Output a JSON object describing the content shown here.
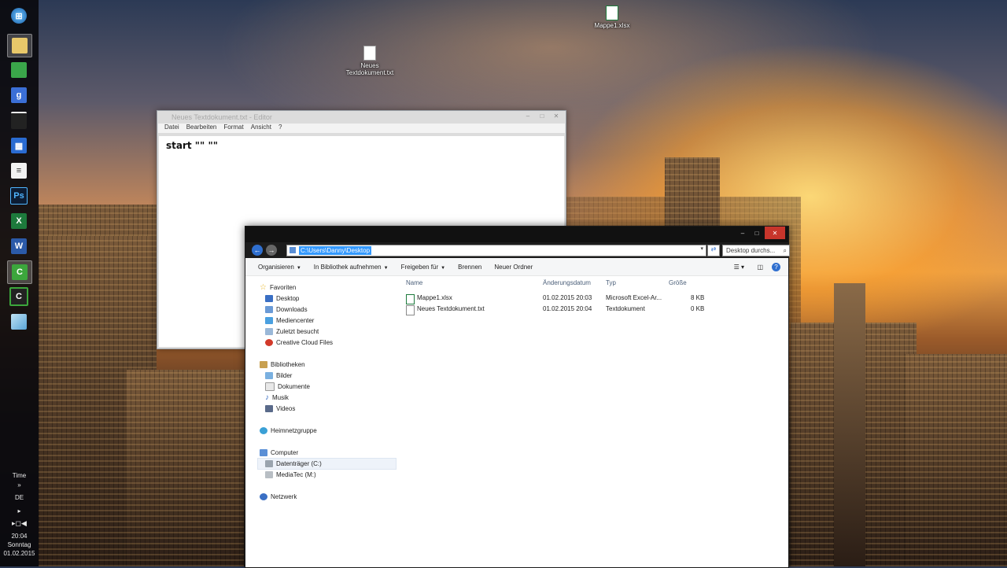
{
  "desktop": {
    "icons": [
      {
        "name": "Mappe1.xlsx"
      },
      {
        "name": "Neues Textdokument.txt"
      }
    ]
  },
  "taskbar": {
    "tray": {
      "time_label": "Time",
      "lang": "DE",
      "clock": "20:04",
      "day": "Sonntag",
      "date": "01.02.2015"
    }
  },
  "notepad": {
    "title": "Neues Textdokument.txt - Editor",
    "menu": [
      "Datei",
      "Bearbeiten",
      "Format",
      "Ansicht",
      "?"
    ],
    "content": "start \"\" \"\""
  },
  "explorer": {
    "address": "C:\\Users\\Danny\\Desktop",
    "search_placeholder": "Desktop durchs...",
    "toolbar": {
      "organize": "Organisieren",
      "library": "In Bibliothek aufnehmen",
      "share": "Freigeben für",
      "burn": "Brennen",
      "new_folder": "Neuer Ordner"
    },
    "nav": {
      "favorites": "Favoriten",
      "favorites_items": [
        "Desktop",
        "Downloads",
        "Mediencenter",
        "Zuletzt besucht",
        "Creative Cloud Files"
      ],
      "libraries": "Bibliotheken",
      "libraries_items": [
        "Bilder",
        "Dokumente",
        "Musik",
        "Videos"
      ],
      "homegroup": "Heimnetzgruppe",
      "computer": "Computer",
      "computer_items": [
        "Datenträger (C:)",
        "MediaTec (M:)"
      ],
      "network": "Netzwerk"
    },
    "columns": {
      "name": "Name",
      "date": "Änderungsdatum",
      "type": "Typ",
      "size": "Größe"
    },
    "files": [
      {
        "name": "Mappe1.xlsx",
        "date": "01.02.2015 20:03",
        "type": "Microsoft Excel-Ar...",
        "size": "8 KB"
      },
      {
        "name": "Neues Textdokument.txt",
        "date": "01.02.2015 20:04",
        "type": "Textdokument",
        "size": "0 KB"
      }
    ]
  },
  "colors": {
    "selection": "#3399ff",
    "close": "#c7352b",
    "excel": "#1d7a3c"
  }
}
